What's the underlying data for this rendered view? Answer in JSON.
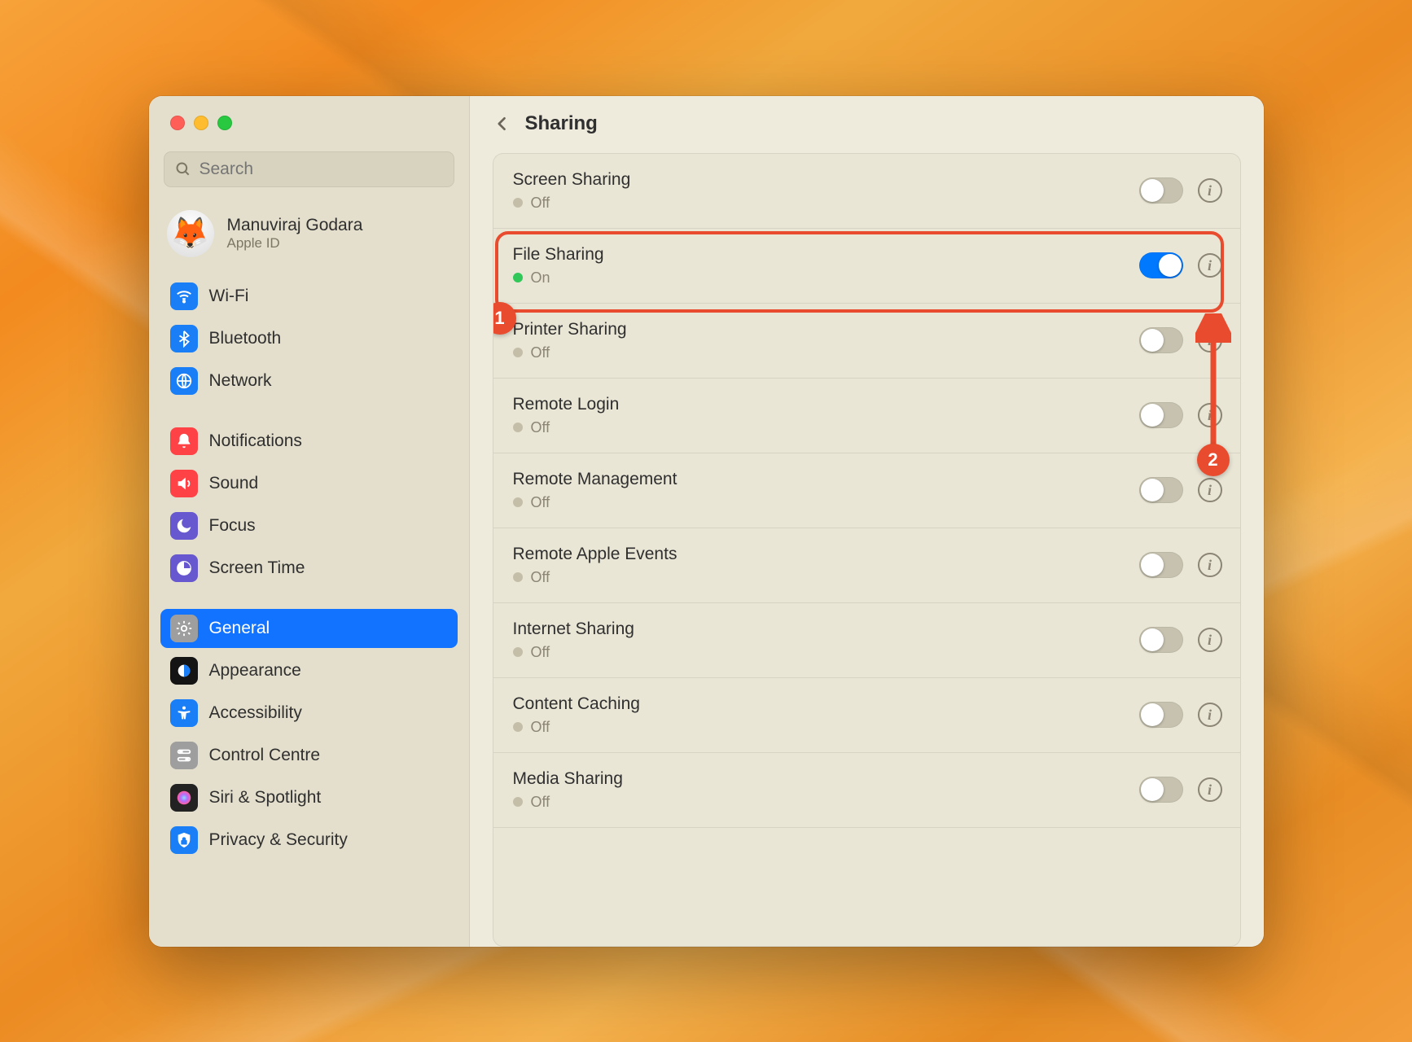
{
  "window_title": "Sharing",
  "search": {
    "placeholder": "Search"
  },
  "profile": {
    "name": "Manuviraj Godara",
    "subtitle": "Apple ID",
    "avatar_emoji": "🦊"
  },
  "sidebar": {
    "items": [
      {
        "label": "Wi-Fi",
        "icon": "wifi",
        "icon_bg": "#1a7ff6",
        "selected": false
      },
      {
        "label": "Bluetooth",
        "icon": "bluetooth",
        "icon_bg": "#1a7ff6",
        "selected": false
      },
      {
        "label": "Network",
        "icon": "network",
        "icon_bg": "#1a7ff6",
        "selected": false
      },
      {
        "sep": true
      },
      {
        "label": "Notifications",
        "icon": "notifications",
        "icon_bg": "#ff4245",
        "selected": false
      },
      {
        "label": "Sound",
        "icon": "sound",
        "icon_bg": "#ff4245",
        "selected": false
      },
      {
        "label": "Focus",
        "icon": "focus",
        "icon_bg": "#6758cf",
        "selected": false
      },
      {
        "label": "Screen Time",
        "icon": "screentime",
        "icon_bg": "#6758cf",
        "selected": false
      },
      {
        "sep": true
      },
      {
        "label": "General",
        "icon": "general",
        "icon_bg": "#9e9e9e",
        "selected": true
      },
      {
        "label": "Appearance",
        "icon": "appearance",
        "icon_bg": "#141414",
        "selected": false
      },
      {
        "label": "Accessibility",
        "icon": "accessibility",
        "icon_bg": "#1a7ff6",
        "selected": false
      },
      {
        "label": "Control Centre",
        "icon": "controlcentre",
        "icon_bg": "#9e9e9e",
        "selected": false
      },
      {
        "label": "Siri & Spotlight",
        "icon": "siri",
        "icon_bg": "#222222",
        "selected": false
      },
      {
        "label": "Privacy & Security",
        "icon": "privacy",
        "icon_bg": "#1a7ff6",
        "selected": false
      }
    ]
  },
  "sharing": {
    "rows": [
      {
        "title": "Screen Sharing",
        "status": "Off",
        "on": false
      },
      {
        "title": "File Sharing",
        "status": "On",
        "on": true,
        "highlighted": true
      },
      {
        "title": "Printer Sharing",
        "status": "Off",
        "on": false
      },
      {
        "title": "Remote Login",
        "status": "Off",
        "on": false
      },
      {
        "title": "Remote Management",
        "status": "Off",
        "on": false
      },
      {
        "title": "Remote Apple Events",
        "status": "Off",
        "on": false
      },
      {
        "title": "Internet Sharing",
        "status": "Off",
        "on": false
      },
      {
        "title": "Content Caching",
        "status": "Off",
        "on": false
      },
      {
        "title": "Media Sharing",
        "status": "Off",
        "on": false
      }
    ]
  },
  "annotations": {
    "badge1": "1",
    "badge2": "2"
  },
  "colors": {
    "accent": "#0079ff",
    "annotation": "#e84b2d",
    "status_on": "#32c759"
  }
}
